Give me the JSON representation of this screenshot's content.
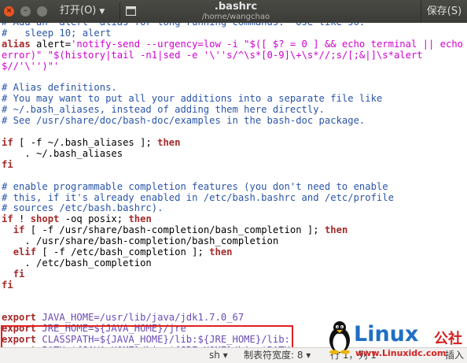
{
  "window": {
    "title": ".bashrc",
    "subtitle": "/home/wangchao",
    "open_label": "打开(O)",
    "save_label": "保存(S)"
  },
  "editor": {
    "lines": [
      [
        {
          "t": "# Add an \"alert\" alias for long running commands.  Use like so:",
          "c": "c"
        }
      ],
      [
        {
          "t": "#   sleep 10; alert",
          "c": "c"
        }
      ],
      [
        {
          "t": "alias",
          "c": "k"
        },
        {
          "t": " alert=",
          "c": ""
        },
        {
          "t": "'notify-send --urgency=low -i \"$([ $? = 0 ] && echo terminal || echo",
          "c": "s"
        }
      ],
      [
        {
          "t": "error)\" \"$(history|tail -n1|sed -e '\\''s/^\\s*[0-9]\\+\\s*//;s/[;&|]\\s*alert",
          "c": "s"
        }
      ],
      [
        {
          "t": "$//'\\'')\"'",
          "c": "s"
        }
      ],
      [
        {
          "t": "",
          "c": ""
        }
      ],
      [
        {
          "t": "# Alias definitions.",
          "c": "c"
        }
      ],
      [
        {
          "t": "# You may want to put all your additions into a separate file like",
          "c": "c"
        }
      ],
      [
        {
          "t": "# ~/.bash_aliases, instead of adding them here directly.",
          "c": "c"
        }
      ],
      [
        {
          "t": "# See /usr/share/doc/bash-doc/examples in the bash-doc package.",
          "c": "c"
        }
      ],
      [
        {
          "t": "",
          "c": ""
        }
      ],
      [
        {
          "t": "if",
          "c": "k"
        },
        {
          "t": " [ -f ~/.bash_aliases ]; ",
          "c": ""
        },
        {
          "t": "then",
          "c": "k"
        }
      ],
      [
        {
          "t": "    . ~/.bash_aliases",
          "c": ""
        }
      ],
      [
        {
          "t": "fi",
          "c": "k"
        }
      ],
      [
        {
          "t": "",
          "c": ""
        }
      ],
      [
        {
          "t": "# enable programmable completion features (you don't need to enable",
          "c": "c"
        }
      ],
      [
        {
          "t": "# this, if it's already enabled in /etc/bash.bashrc and /etc/profile",
          "c": "c"
        }
      ],
      [
        {
          "t": "# sources /etc/bash.bashrc).",
          "c": "c"
        }
      ],
      [
        {
          "t": "if",
          "c": "k"
        },
        {
          "t": " ! ",
          "c": ""
        },
        {
          "t": "shopt",
          "c": "k"
        },
        {
          "t": " -oq posix; ",
          "c": ""
        },
        {
          "t": "then",
          "c": "k"
        }
      ],
      [
        {
          "t": "  ",
          "c": ""
        },
        {
          "t": "if",
          "c": "k"
        },
        {
          "t": " [ -f /usr/share/bash-completion/bash_completion ]; ",
          "c": ""
        },
        {
          "t": "then",
          "c": "k"
        }
      ],
      [
        {
          "t": "    . /usr/share/bash-completion/bash_completion",
          "c": ""
        }
      ],
      [
        {
          "t": "  ",
          "c": ""
        },
        {
          "t": "elif",
          "c": "k"
        },
        {
          "t": " [ -f /etc/bash_completion ]; ",
          "c": ""
        },
        {
          "t": "then",
          "c": "k"
        }
      ],
      [
        {
          "t": "    . /etc/bash_completion",
          "c": ""
        }
      ],
      [
        {
          "t": "  ",
          "c": ""
        },
        {
          "t": "fi",
          "c": "k"
        }
      ],
      [
        {
          "t": "fi",
          "c": "k"
        }
      ],
      [
        {
          "t": "",
          "c": ""
        }
      ],
      [
        {
          "t": "",
          "c": ""
        }
      ],
      [
        {
          "t": "export",
          "c": "k"
        },
        {
          "t": " JAVA_HOME=/usr/lib/java/jdk1.7.0_67",
          "c": "p"
        }
      ],
      [
        {
          "t": "export",
          "c": "k"
        },
        {
          "t": " JRE_HOME=${JAVA_HOME}/jre",
          "c": "p"
        }
      ],
      [
        {
          "t": "export",
          "c": "k"
        },
        {
          "t": " CLASSPATH=${JAVA_HOME}/lib:${JRE_HOME}/lib:",
          "c": "p"
        }
      ],
      [
        {
          "t": "export",
          "c": "k"
        },
        {
          "t": " PATH=${JAVA_HOME}/bin:${JRE_HOME}/bin:$PATH",
          "c": "p"
        }
      ]
    ]
  },
  "statusbar": {
    "language": "sh ▾",
    "tab_width": "制表符宽度: 8 ▾",
    "position": "行 1，列 1",
    "mode": "插入"
  },
  "watermark": {
    "brand": "Linux",
    "brand_cn": "公社",
    "url": "www.Linuxidc.com"
  },
  "colors": {
    "comment": "#2a55a8",
    "keyword": "#a52a2a",
    "string": "#d100d1",
    "highlight_border": "#e02020",
    "headerbar": "#3b3b37"
  },
  "icons": [
    "close-icon",
    "minimize-icon",
    "maximize-icon",
    "new-tab-icon",
    "chevron-down-icon",
    "tux-penguin-icon"
  ]
}
